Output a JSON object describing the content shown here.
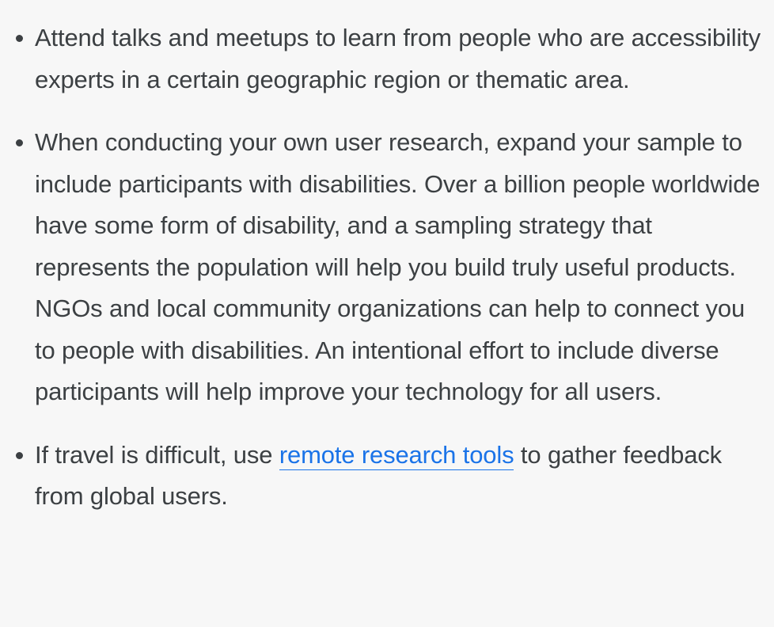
{
  "bullets": [
    {
      "text": "Attend talks and meetups to learn from people who are accessibility experts in a certain geographic region or thematic area."
    },
    {
      "text": "When conducting your own user research, expand your sample to include participants with disabilities. Over a billion people worldwide have some form of disability, and a sampling strategy that represents the population will help you build truly useful products. NGOs and local community organizations can help to connect you to people with disabilities. An intentional effort to include diverse participants will help improve your technology for all users."
    },
    {
      "before": "If travel is difficult, use ",
      "link": "remote research tools",
      "after": " to gather feedback from global users."
    }
  ],
  "colors": {
    "background": "#f7f7f7",
    "text": "#3c4043",
    "link": "#1a73e8"
  }
}
